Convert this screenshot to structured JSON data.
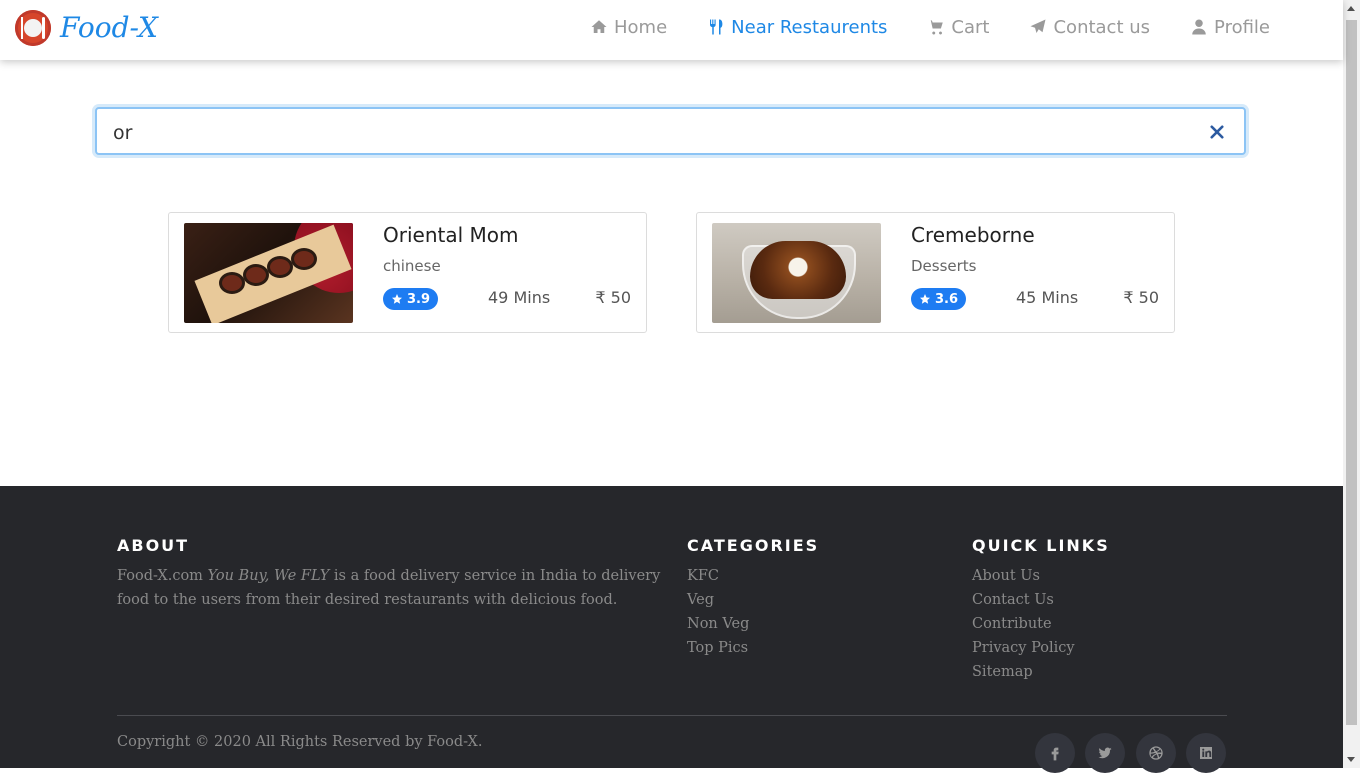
{
  "brand": {
    "name": "Food-X"
  },
  "nav": {
    "items": [
      {
        "label": "Home",
        "icon": "home-icon",
        "active": false
      },
      {
        "label": "Near Restaurents",
        "icon": "cutlery-icon",
        "active": true
      },
      {
        "label": "Cart",
        "icon": "cart-icon",
        "active": false
      },
      {
        "label": "Contact us",
        "icon": "paper-plane-icon",
        "active": false
      },
      {
        "label": "Profile",
        "icon": "user-icon",
        "active": false
      }
    ]
  },
  "search": {
    "value": "or",
    "clear_icon": "close-icon"
  },
  "restaurants": [
    {
      "name": "Oriental Mom",
      "cuisine": "chinese",
      "rating": "3.9",
      "time": "49 Mins",
      "price": "₹ 50"
    },
    {
      "name": "Cremeborne",
      "cuisine": "Desserts",
      "rating": "3.6",
      "time": "45 Mins",
      "price": "₹ 50"
    }
  ],
  "footer": {
    "about": {
      "title": "ABOUT",
      "text_prefix": "Food-X.com ",
      "text_em": "You Buy, We FLY",
      "text_suffix": " is a food delivery service in India to delivery food to the users from their desired restaurants with delicious food."
    },
    "categories": {
      "title": "CATEGORIES",
      "items": [
        "KFC",
        "Veg",
        "Non Veg",
        "Top Pics"
      ]
    },
    "quick_links": {
      "title": "QUICK LINKS",
      "items": [
        "About Us",
        "Contact Us",
        "Contribute",
        "Privacy Policy",
        "Sitemap"
      ]
    },
    "copyright": "Copyright © 2020 All Rights Reserved by Food-X.",
    "social": [
      "facebook-icon",
      "twitter-icon",
      "dribbble-icon",
      "linkedin-icon"
    ]
  },
  "colors": {
    "accent": "#1e88e5",
    "rating_badge": "#1e7cf2",
    "footer_bg": "#26272b"
  }
}
